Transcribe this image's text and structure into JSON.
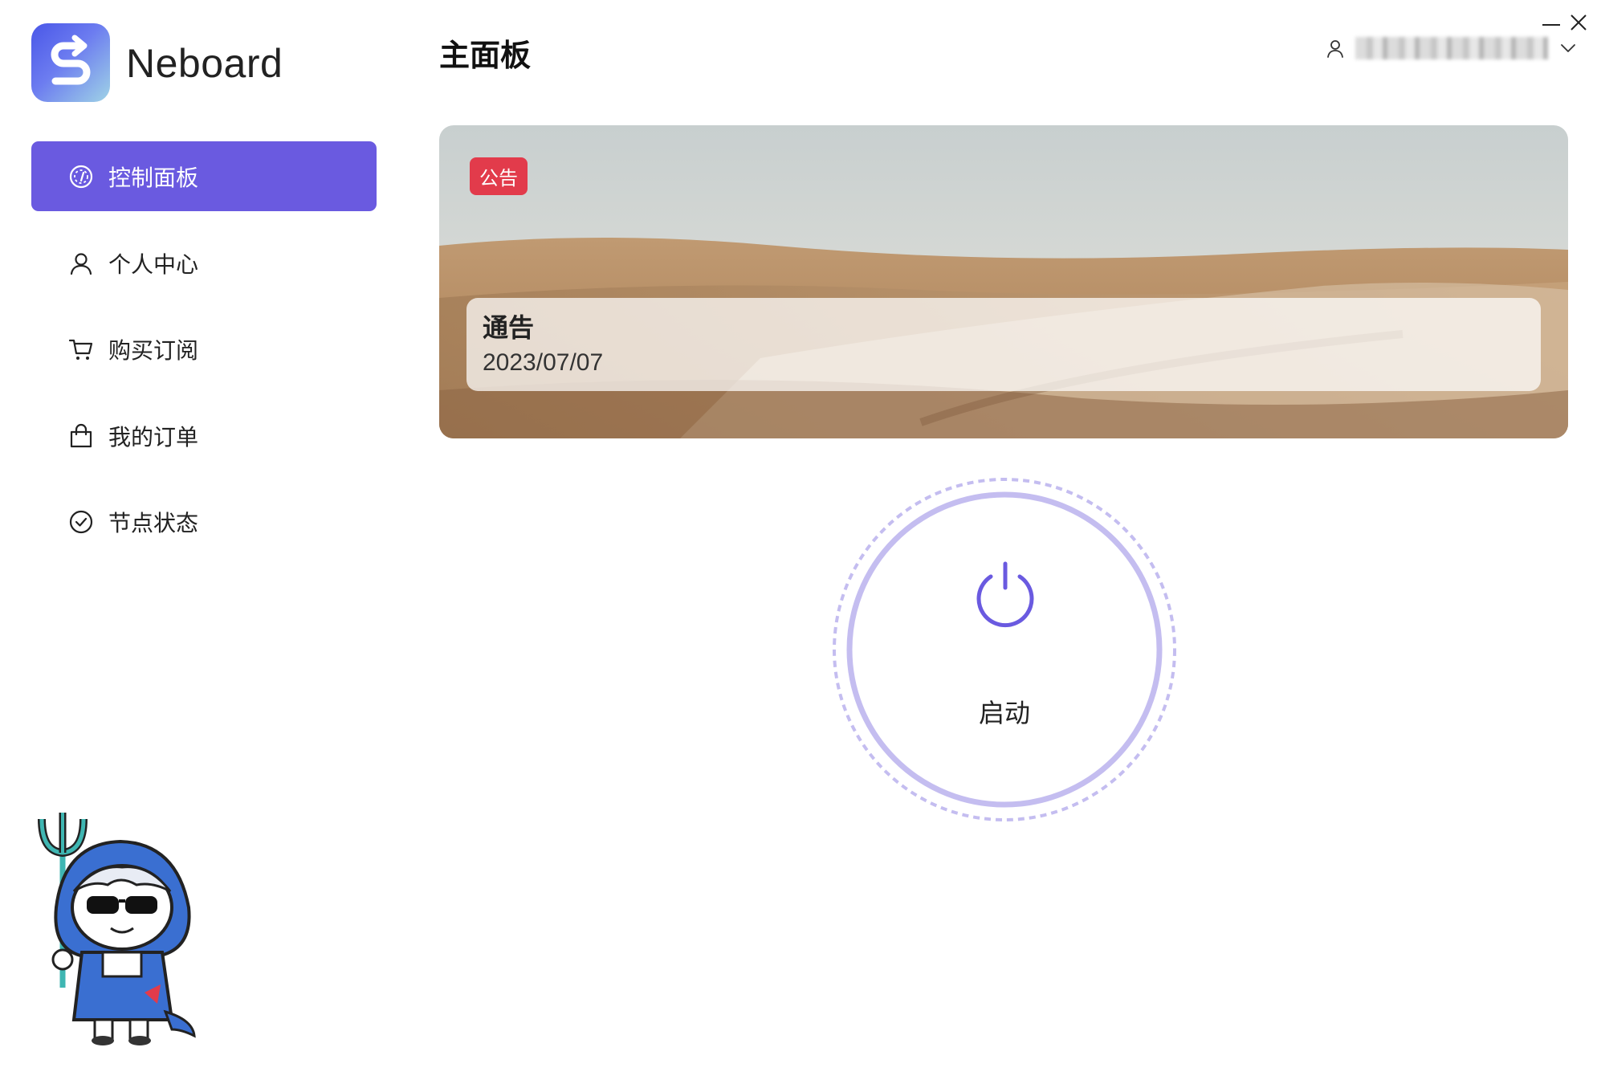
{
  "app": {
    "brand": "Neboard"
  },
  "sidebar": {
    "items": [
      {
        "label": "控制面板",
        "icon": "dashboard-icon",
        "active": true
      },
      {
        "label": "个人中心",
        "icon": "user-icon",
        "active": false
      },
      {
        "label": "购买订阅",
        "icon": "cart-icon",
        "active": false
      },
      {
        "label": "我的订单",
        "icon": "bag-icon",
        "active": false
      },
      {
        "label": "节点状态",
        "icon": "check-circle-icon",
        "active": false
      }
    ]
  },
  "header": {
    "title": "主面板",
    "user_icon": "user-icon",
    "dropdown_icon": "chevron-down-icon"
  },
  "window_controls": {
    "minimize_icon": "minimize-icon",
    "close_icon": "close-icon"
  },
  "notice": {
    "tag": "公告",
    "title": "通告",
    "date": "2023/07/07"
  },
  "power": {
    "label": "启动",
    "icon": "power-icon"
  },
  "colors": {
    "accent": "#6a5ae0",
    "ring": "#c4bdf0",
    "tag": "#e23b4b"
  }
}
